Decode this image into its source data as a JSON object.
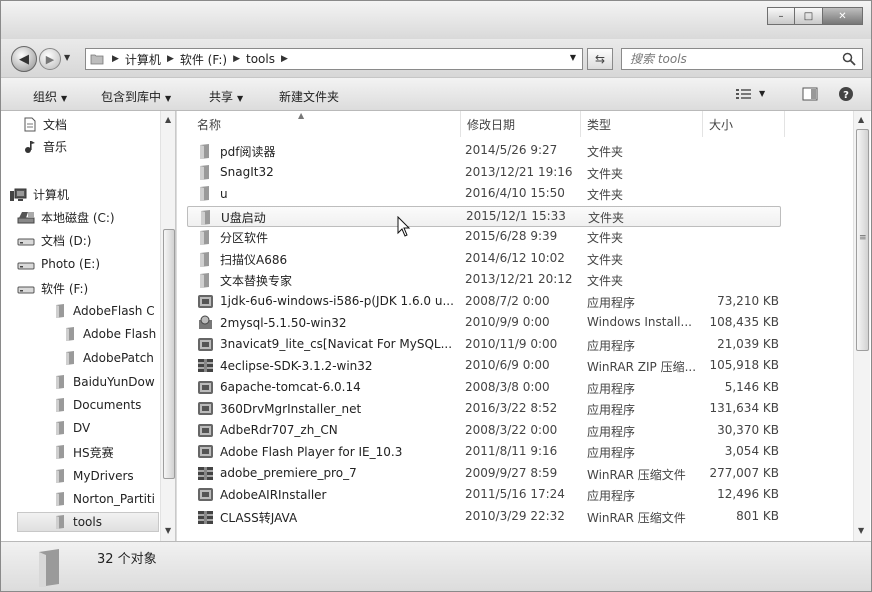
{
  "window": {
    "controls": {
      "minimize": "–",
      "maximize": "□",
      "close": "✕"
    }
  },
  "address_bar": {
    "breadcrumbs": [
      "计算机",
      "软件 (F:)",
      "tools"
    ]
  },
  "search": {
    "placeholder": "搜索 tools"
  },
  "toolbar": {
    "organize": "组织",
    "include_in_library": "包含到库中",
    "share": "共享",
    "new_folder": "新建文件夹"
  },
  "nav": {
    "items": [
      {
        "label": "文档",
        "icon": "document-icon"
      },
      {
        "label": "音乐",
        "icon": "music-icon"
      },
      {
        "label": "计算机",
        "icon": "computer-icon"
      },
      {
        "label": "本地磁盘 (C:)",
        "icon": "local-disk-icon"
      },
      {
        "label": "文档 (D:)",
        "icon": "drive-icon"
      },
      {
        "label": "Photo (E:)",
        "icon": "drive-icon"
      },
      {
        "label": "软件 (F:)",
        "icon": "drive-icon"
      },
      {
        "label": "AdobeFlash C",
        "icon": "folder-icon"
      },
      {
        "label": "Adobe Flash",
        "icon": "folder-icon"
      },
      {
        "label": "AdobePatch",
        "icon": "folder-icon"
      },
      {
        "label": "BaiduYunDow",
        "icon": "folder-icon"
      },
      {
        "label": "Documents",
        "icon": "folder-icon"
      },
      {
        "label": "DV",
        "icon": "folder-icon"
      },
      {
        "label": "HS竞赛",
        "icon": "folder-icon"
      },
      {
        "label": "MyDrivers",
        "icon": "folder-icon"
      },
      {
        "label": "Norton_Partiti",
        "icon": "folder-icon"
      },
      {
        "label": "tools",
        "icon": "folder-icon"
      }
    ]
  },
  "columns": {
    "name": "名称",
    "date": "修改日期",
    "type": "类型",
    "size": "大小"
  },
  "files": [
    {
      "name": "pdf阅读器",
      "date": "2014/5/26 9:27",
      "type": "文件夹",
      "size": "",
      "icon": "folder-icon"
    },
    {
      "name": "SnagIt32",
      "date": "2013/12/21 19:16",
      "type": "文件夹",
      "size": "",
      "icon": "folder-icon"
    },
    {
      "name": "u",
      "date": "2016/4/10 15:50",
      "type": "文件夹",
      "size": "",
      "icon": "folder-icon"
    },
    {
      "name": "U盘启动",
      "date": "2015/12/1 15:33",
      "type": "文件夹",
      "size": "",
      "icon": "folder-icon"
    },
    {
      "name": "分区软件",
      "date": "2015/6/28 9:39",
      "type": "文件夹",
      "size": "",
      "icon": "folder-icon"
    },
    {
      "name": "扫描仪A686",
      "date": "2014/6/12 10:02",
      "type": "文件夹",
      "size": "",
      "icon": "folder-icon"
    },
    {
      "name": "文本替换专家",
      "date": "2013/12/21 20:12",
      "type": "文件夹",
      "size": "",
      "icon": "folder-icon"
    },
    {
      "name": "1jdk-6u6-windows-i586-p(JDK 1.6.0 u...",
      "date": "2008/7/2 0:00",
      "type": "应用程序",
      "size": "73,210 KB",
      "icon": "app-icon"
    },
    {
      "name": "2mysql-5.1.50-win32",
      "date": "2010/9/9 0:00",
      "type": "Windows Install...",
      "size": "108,435 KB",
      "icon": "installer-icon"
    },
    {
      "name": "3navicat9_lite_cs[Navicat For MySQL...",
      "date": "2010/11/9 0:00",
      "type": "应用程序",
      "size": "21,039 KB",
      "icon": "app-icon"
    },
    {
      "name": "4eclipse-SDK-3.1.2-win32",
      "date": "2010/6/9 0:00",
      "type": "WinRAR ZIP 压缩...",
      "size": "105,918 KB",
      "icon": "archive-icon"
    },
    {
      "name": "6apache-tomcat-6.0.14",
      "date": "2008/3/8 0:00",
      "type": "应用程序",
      "size": "5,146 KB",
      "icon": "app-icon"
    },
    {
      "name": "360DrvMgrInstaller_net",
      "date": "2016/3/22 8:52",
      "type": "应用程序",
      "size": "131,634 KB",
      "icon": "app-icon"
    },
    {
      "name": "AdbeRdr707_zh_CN",
      "date": "2008/3/22 0:00",
      "type": "应用程序",
      "size": "30,370 KB",
      "icon": "app-icon"
    },
    {
      "name": "Adobe Flash Player for IE_10.3",
      "date": "2011/8/11 9:16",
      "type": "应用程序",
      "size": "3,054 KB",
      "icon": "app-icon"
    },
    {
      "name": "adobe_premiere_pro_7",
      "date": "2009/9/27 8:59",
      "type": "WinRAR 压缩文件",
      "size": "277,007 KB",
      "icon": "archive-icon"
    },
    {
      "name": "AdobeAIRInstaller",
      "date": "2011/5/16 17:24",
      "type": "应用程序",
      "size": "12,496 KB",
      "icon": "app-icon"
    },
    {
      "name": "CLASS转JAVA",
      "date": "2010/3/29 22:32",
      "type": "WinRAR 压缩文件",
      "size": "801 KB",
      "icon": "archive-icon"
    }
  ],
  "details": {
    "count_text": "32 个对象"
  }
}
